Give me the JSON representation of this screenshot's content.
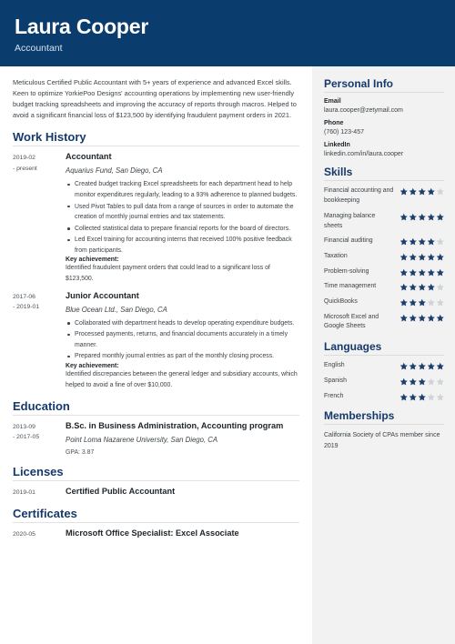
{
  "header": {
    "name": "Laura Cooper",
    "job_title": "Accountant",
    "bg_color": "#0a3d6e"
  },
  "summary": "Meticulous Certified Public Accountant with 5+ years of experience and advanced Excel skills. Keen to optimize YorkiePoo Designs' accounting operations by implementing new user-friendly budget tracking spreadsheets and improving the accuracy of reports through macros. Helped to avoid a significant financial loss of $123,500 by identifying fraudulent payment orders in 2021.",
  "sections": {
    "work_history": {
      "title": "Work History",
      "entries": [
        {
          "date": "2019-02\n- present",
          "role": "Accountant",
          "org": "Aquarius Fund, San Diego, CA",
          "bullets": [
            "Created budget tracking Excel spreadsheets for each department head to help monitor expenditures regularly, leading to a 93% adherence to planned budgets.",
            "Used Pivot Tables to pull data from a range of sources in order to automate the creation of monthly journal entries and tax statements.",
            "Collected statistical data to prepare financial reports for the board of directors.",
            "Led Excel training for accounting interns that received 100% positive feedback from participants."
          ],
          "key_achievement_label": "Key achievement:",
          "key_achievement_text": "Identified fraudulent payment orders that could lead to a significant loss of $123,500."
        },
        {
          "date": "2017-06\n- 2019-01",
          "role": "Junior Accountant",
          "org": "Blue Ocean Ltd., San Diego, CA",
          "bullets": [
            "Collaborated with department heads to develop operating expenditure budgets.",
            "Processed payments, returns, and financial documents accurately in a timely manner.",
            "Prepared monthly journal entries as part of the monthly closing process."
          ],
          "key_achievement_label": "Key achievement:",
          "key_achievement_text": "Identified discrepancies between the general ledger and subsidiary accounts, which helped to avoid a fine of over $10,000."
        }
      ]
    },
    "education": {
      "title": "Education",
      "entries": [
        {
          "date": "2013-09\n- 2017-05",
          "role": "B.Sc. in Business Administration, Accounting program",
          "org": "Point Loma Nazarene University, San Diego, CA",
          "gpa": "GPA: 3.87"
        }
      ]
    },
    "licenses": {
      "title": "Licenses",
      "entries": [
        {
          "date": "2019-01",
          "role": "Certified Public Accountant"
        }
      ]
    },
    "certificates": {
      "title": "Certificates",
      "entries": [
        {
          "date": "2020-05",
          "role": "Microsoft Office Specialist: Excel Associate"
        }
      ]
    }
  },
  "sidebar": {
    "personal_info": {
      "title": "Personal Info",
      "fields": [
        {
          "label": "Email",
          "value": "laura.cooper@zetymail.com"
        },
        {
          "label": "Phone",
          "value": "(760) 123-457"
        },
        {
          "label": "LinkedIn",
          "value": "linkedin.com/in/laura.cooper"
        }
      ]
    },
    "skills": {
      "title": "Skills",
      "max_rating": 5,
      "items": [
        {
          "label": "Financial accounting and bookkeeping",
          "rating": 4
        },
        {
          "label": "Managing balance sheets",
          "rating": 5
        },
        {
          "label": "Financial auditing",
          "rating": 4
        },
        {
          "label": "Taxation",
          "rating": 5
        },
        {
          "label": "Problem-solving",
          "rating": 5
        },
        {
          "label": "Time management",
          "rating": 4
        },
        {
          "label": "QuickBooks",
          "rating": 3
        },
        {
          "label": "Microsoft Excel and Google Sheets",
          "rating": 5
        }
      ]
    },
    "languages": {
      "title": "Languages",
      "max_rating": 5,
      "items": [
        {
          "label": "English",
          "rating": 5
        },
        {
          "label": "Spanish",
          "rating": 3
        },
        {
          "label": "French",
          "rating": 3
        }
      ]
    },
    "memberships": {
      "title": "Memberships",
      "text": "California Society of CPAs member since 2019"
    }
  },
  "colors": {
    "accent_navy": "#0a3d6e",
    "heading_navy": "#15396b",
    "star_on": "#1d3f6d",
    "star_off": "#cdd4da",
    "sidebar_bg": "#f2f2f2"
  }
}
